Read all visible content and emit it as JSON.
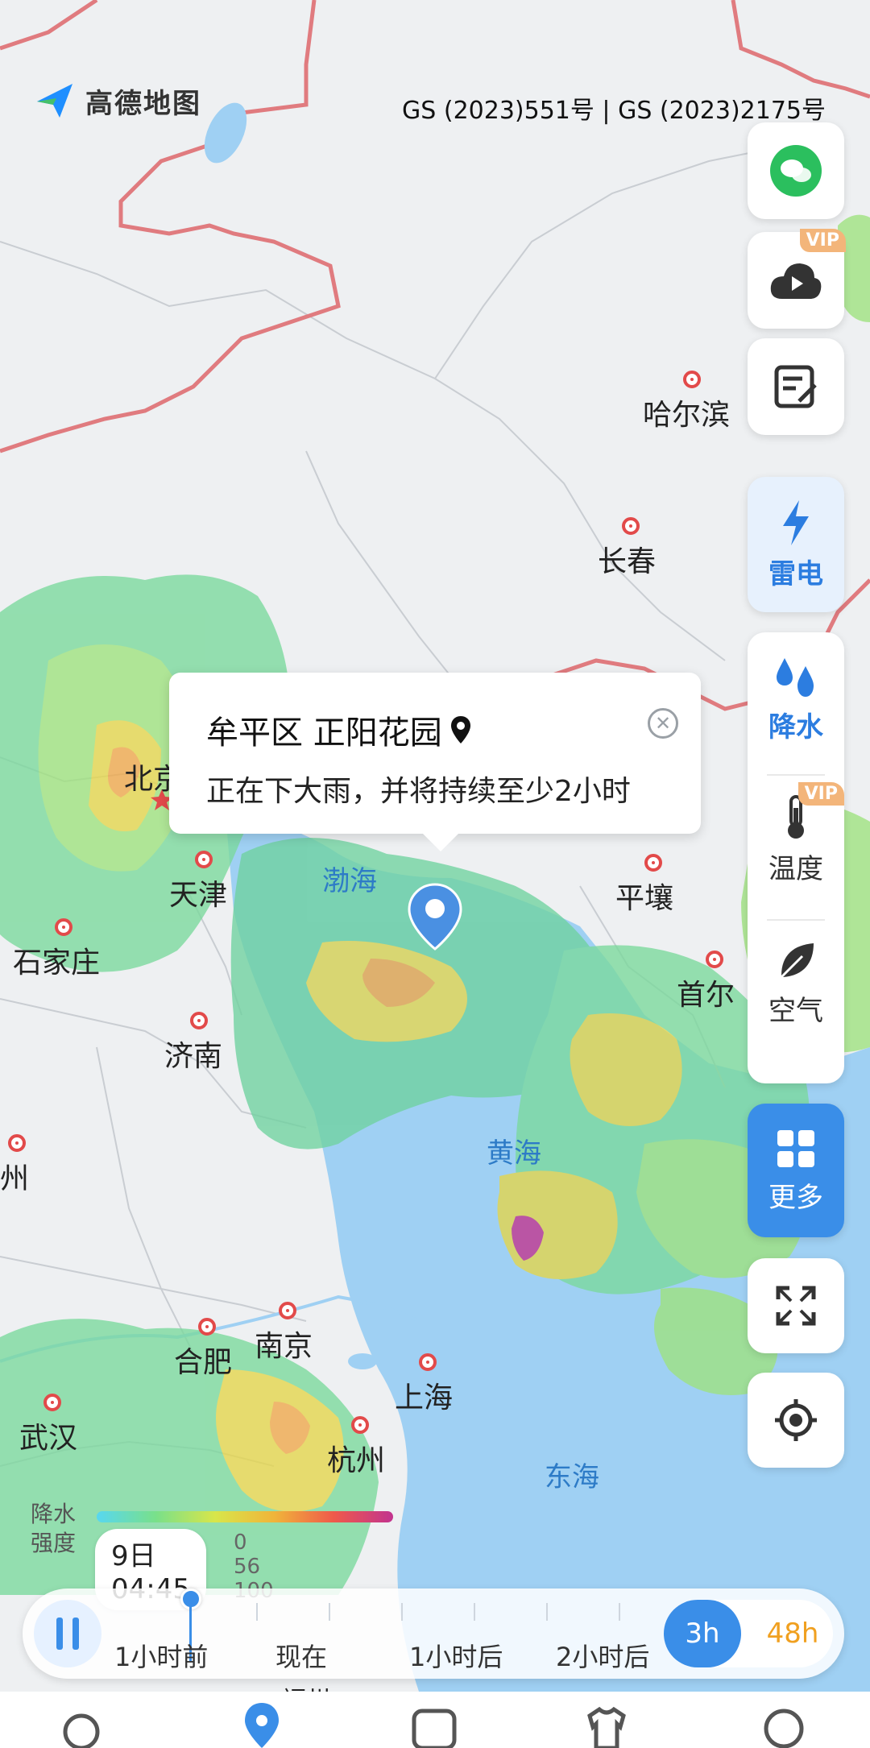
{
  "app": {
    "brand": "高德地图",
    "approval": "GS (2023)551号 | GS (2023)2175号"
  },
  "cities": [
    {
      "name": "哈尔滨"
    },
    {
      "name": "长春"
    },
    {
      "name": "北京"
    },
    {
      "name": "天津"
    },
    {
      "name": "石家庄"
    },
    {
      "name": "济南"
    },
    {
      "name": "郑州"
    },
    {
      "name": "平壤"
    },
    {
      "name": "首尔"
    },
    {
      "name": "南京"
    },
    {
      "name": "合肥"
    },
    {
      "name": "上海"
    },
    {
      "name": "杭州"
    },
    {
      "name": "武汉"
    },
    {
      "name": "福州"
    }
  ],
  "seas": {
    "bohai": "渤海",
    "huanghai": "黄海",
    "donghai": "东海"
  },
  "popup": {
    "location": "牟平区 正阳花园",
    "message": "正在下大雨，并将持续至少2小时"
  },
  "side": {
    "wechat_icon": "wechat-icon",
    "cloud_vip": "VIP",
    "thunder": "雷电",
    "rain": "降水",
    "temp": "温度",
    "temp_vip": "VIP",
    "air": "空气",
    "more": "更多"
  },
  "legend": {
    "title_line1": "降水",
    "title_line2": "强度",
    "ticks": "0   56   100",
    "time": "9日 04:45"
  },
  "timeline": {
    "labels": [
      "1小时前",
      "现在",
      "1小时后",
      "2小时后"
    ],
    "range_3h": "3h",
    "range_48h": "48h"
  },
  "colors": {
    "accent": "#3a8ee8",
    "vip": "#f3b57a",
    "city": "#e24a4a"
  }
}
